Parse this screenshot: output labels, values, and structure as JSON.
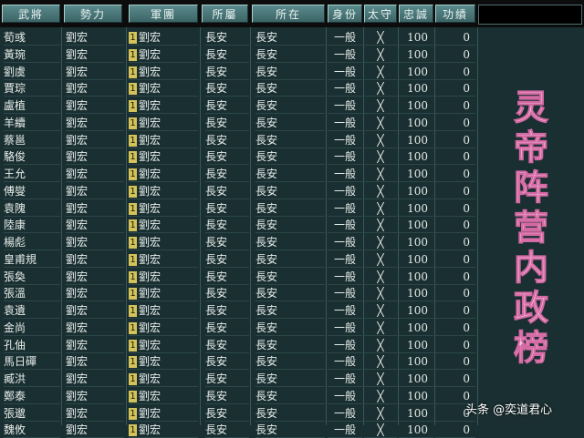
{
  "headers": [
    "武將",
    "勢力",
    "軍團",
    "所屬",
    "所在",
    "身份",
    "太守",
    "忠誠",
    "功績"
  ],
  "rows": [
    {
      "name": "荀彧",
      "faction": "劉宏",
      "corps_no": "1",
      "corps": "劉宏",
      "belong": "長安",
      "location": "長安",
      "status": "一般",
      "governor": "╳",
      "loyalty": "100",
      "merit": "0"
    },
    {
      "name": "黃琬",
      "faction": "劉宏",
      "corps_no": "1",
      "corps": "劉宏",
      "belong": "長安",
      "location": "長安",
      "status": "一般",
      "governor": "╳",
      "loyalty": "100",
      "merit": "0"
    },
    {
      "name": "劉虞",
      "faction": "劉宏",
      "corps_no": "1",
      "corps": "劉宏",
      "belong": "長安",
      "location": "長安",
      "status": "一般",
      "governor": "╳",
      "loyalty": "100",
      "merit": "0"
    },
    {
      "name": "賈琮",
      "faction": "劉宏",
      "corps_no": "1",
      "corps": "劉宏",
      "belong": "長安",
      "location": "長安",
      "status": "一般",
      "governor": "╳",
      "loyalty": "100",
      "merit": "0"
    },
    {
      "name": "盧植",
      "faction": "劉宏",
      "corps_no": "1",
      "corps": "劉宏",
      "belong": "長安",
      "location": "長安",
      "status": "一般",
      "governor": "╳",
      "loyalty": "100",
      "merit": "0"
    },
    {
      "name": "羊續",
      "faction": "劉宏",
      "corps_no": "1",
      "corps": "劉宏",
      "belong": "長安",
      "location": "長安",
      "status": "一般",
      "governor": "╳",
      "loyalty": "100",
      "merit": "0"
    },
    {
      "name": "蔡邕",
      "faction": "劉宏",
      "corps_no": "1",
      "corps": "劉宏",
      "belong": "長安",
      "location": "長安",
      "status": "一般",
      "governor": "╳",
      "loyalty": "100",
      "merit": "0"
    },
    {
      "name": "駱俊",
      "faction": "劉宏",
      "corps_no": "1",
      "corps": "劉宏",
      "belong": "長安",
      "location": "長安",
      "status": "一般",
      "governor": "╳",
      "loyalty": "100",
      "merit": "0"
    },
    {
      "name": "王允",
      "faction": "劉宏",
      "corps_no": "1",
      "corps": "劉宏",
      "belong": "長安",
      "location": "長安",
      "status": "一般",
      "governor": "╳",
      "loyalty": "100",
      "merit": "0"
    },
    {
      "name": "傅燮",
      "faction": "劉宏",
      "corps_no": "1",
      "corps": "劉宏",
      "belong": "長安",
      "location": "長安",
      "status": "一般",
      "governor": "╳",
      "loyalty": "100",
      "merit": "0"
    },
    {
      "name": "袁隗",
      "faction": "劉宏",
      "corps_no": "1",
      "corps": "劉宏",
      "belong": "長安",
      "location": "長安",
      "status": "一般",
      "governor": "╳",
      "loyalty": "100",
      "merit": "0"
    },
    {
      "name": "陸康",
      "faction": "劉宏",
      "corps_no": "1",
      "corps": "劉宏",
      "belong": "長安",
      "location": "長安",
      "status": "一般",
      "governor": "╳",
      "loyalty": "100",
      "merit": "0"
    },
    {
      "name": "楊彪",
      "faction": "劉宏",
      "corps_no": "1",
      "corps": "劉宏",
      "belong": "長安",
      "location": "長安",
      "status": "一般",
      "governor": "╳",
      "loyalty": "100",
      "merit": "0"
    },
    {
      "name": "皇甫規",
      "faction": "劉宏",
      "corps_no": "1",
      "corps": "劉宏",
      "belong": "長安",
      "location": "長安",
      "status": "一般",
      "governor": "╳",
      "loyalty": "100",
      "merit": "0"
    },
    {
      "name": "張奐",
      "faction": "劉宏",
      "corps_no": "1",
      "corps": "劉宏",
      "belong": "長安",
      "location": "長安",
      "status": "一般",
      "governor": "╳",
      "loyalty": "100",
      "merit": "0"
    },
    {
      "name": "張溫",
      "faction": "劉宏",
      "corps_no": "1",
      "corps": "劉宏",
      "belong": "長安",
      "location": "長安",
      "status": "一般",
      "governor": "╳",
      "loyalty": "100",
      "merit": "0"
    },
    {
      "name": "袁遺",
      "faction": "劉宏",
      "corps_no": "1",
      "corps": "劉宏",
      "belong": "長安",
      "location": "長安",
      "status": "一般",
      "governor": "╳",
      "loyalty": "100",
      "merit": "0"
    },
    {
      "name": "金尚",
      "faction": "劉宏",
      "corps_no": "1",
      "corps": "劉宏",
      "belong": "長安",
      "location": "長安",
      "status": "一般",
      "governor": "╳",
      "loyalty": "100",
      "merit": "0"
    },
    {
      "name": "孔伷",
      "faction": "劉宏",
      "corps_no": "1",
      "corps": "劉宏",
      "belong": "長安",
      "location": "長安",
      "status": "一般",
      "governor": "╳",
      "loyalty": "100",
      "merit": "0"
    },
    {
      "name": "馬日磾",
      "faction": "劉宏",
      "corps_no": "1",
      "corps": "劉宏",
      "belong": "長安",
      "location": "長安",
      "status": "一般",
      "governor": "╳",
      "loyalty": "100",
      "merit": "0"
    },
    {
      "name": "臧洪",
      "faction": "劉宏",
      "corps_no": "1",
      "corps": "劉宏",
      "belong": "長安",
      "location": "長安",
      "status": "一般",
      "governor": "╳",
      "loyalty": "100",
      "merit": "0"
    },
    {
      "name": "鄭泰",
      "faction": "劉宏",
      "corps_no": "1",
      "corps": "劉宏",
      "belong": "長安",
      "location": "長安",
      "status": "一般",
      "governor": "╳",
      "loyalty": "100",
      "merit": "0"
    },
    {
      "name": "張邈",
      "faction": "劉宏",
      "corps_no": "1",
      "corps": "劉宏",
      "belong": "長安",
      "location": "長安",
      "status": "一般",
      "governor": "╳",
      "loyalty": "100",
      "merit": "0"
    },
    {
      "name": "魏攸",
      "faction": "劉宏",
      "corps_no": "1",
      "corps": "劉宏",
      "belong": "長安",
      "location": "長安",
      "status": "一般",
      "governor": "╳",
      "loyalty": "100",
      "merit": "0"
    }
  ],
  "overlay_title": "灵帝阵营内政榜",
  "watermark": "头条 @奕道君心",
  "colors": {
    "accent": "#d46aa4",
    "badge": "#d4c25a",
    "background": "#1a2f31"
  }
}
